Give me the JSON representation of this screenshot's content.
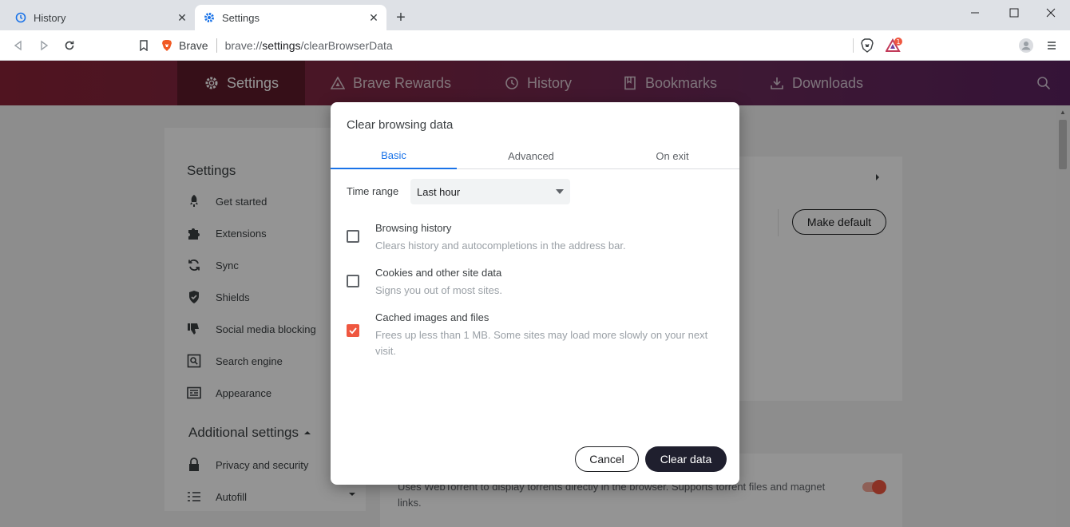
{
  "browser": {
    "tabs": [
      {
        "title": "History",
        "icon": "history-icon"
      },
      {
        "title": "Settings",
        "icon": "gear-icon"
      }
    ],
    "address": {
      "site_label": "Brave",
      "url_prefix": "brave://",
      "url_host": "settings",
      "url_path": "/clearBrowserData"
    },
    "rewards_badge": "1"
  },
  "settings_nav": [
    {
      "label": "Settings",
      "icon": "gear-icon",
      "active": true
    },
    {
      "label": "Brave Rewards",
      "icon": "triangle-icon"
    },
    {
      "label": "History",
      "icon": "history-icon"
    },
    {
      "label": "Bookmarks",
      "icon": "bookmark-icon"
    },
    {
      "label": "Downloads",
      "icon": "download-icon"
    }
  ],
  "sidebar": {
    "title": "Settings",
    "items": [
      {
        "label": "Get started",
        "icon": "rocket-icon"
      },
      {
        "label": "Extensions",
        "icon": "puzzle-icon"
      },
      {
        "label": "Sync",
        "icon": "sync-icon"
      },
      {
        "label": "Shields",
        "icon": "shield-icon"
      },
      {
        "label": "Social media blocking",
        "icon": "thumbs-down-icon"
      },
      {
        "label": "Search engine",
        "icon": "search-engine-icon"
      },
      {
        "label": "Appearance",
        "icon": "appearance-icon"
      }
    ],
    "additional_title": "Additional settings",
    "additional_items": [
      {
        "label": "Privacy and security",
        "icon": "lock-icon"
      },
      {
        "label": "Autofill",
        "icon": "list-icon"
      }
    ]
  },
  "background": {
    "make_default_label": "Make default",
    "webtorrent_text": "Uses WebTorrent to display torrents directly in the browser. Supports torrent files and magnet links."
  },
  "dialog": {
    "title": "Clear browsing data",
    "tabs": [
      "Basic",
      "Advanced",
      "On exit"
    ],
    "active_tab": "Basic",
    "time_range_label": "Time range",
    "time_range_value": "Last hour",
    "options": [
      {
        "label": "Browsing history",
        "description": "Clears history and autocompletions in the address bar.",
        "checked": false
      },
      {
        "label": "Cookies and other site data",
        "description": "Signs you out of most sites.",
        "checked": false
      },
      {
        "label": "Cached images and files",
        "description": "Frees up less than 1 MB. Some sites may load more slowly on your next visit.",
        "checked": true
      }
    ],
    "cancel_label": "Cancel",
    "clear_label": "Clear data"
  },
  "colors": {
    "accent_blue": "#1a73e8",
    "checkbox_orange": "#ef5740",
    "primary_button": "#1f1f2e"
  }
}
